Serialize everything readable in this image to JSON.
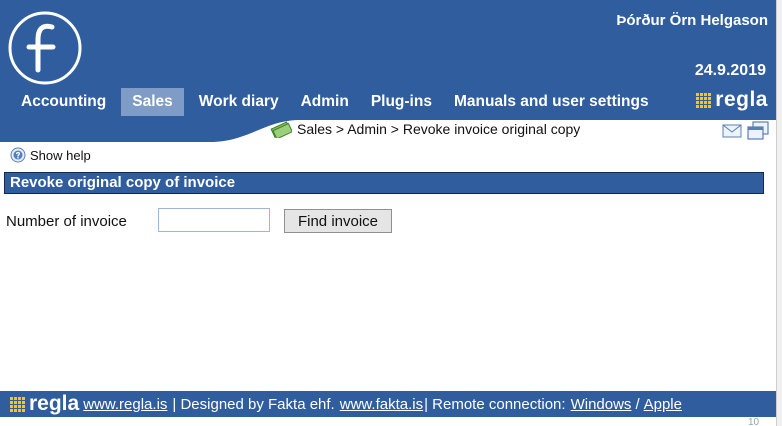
{
  "user": {
    "name": "Þórður Örn Helgason",
    "date": "24.9.2019"
  },
  "nav": {
    "items": [
      {
        "label": "Accounting"
      },
      {
        "label": "Sales",
        "active": true
      },
      {
        "label": "Work diary"
      },
      {
        "label": "Admin"
      },
      {
        "label": "Plug-ins"
      },
      {
        "label": "Manuals and user settings"
      }
    ]
  },
  "brand": {
    "name": "regla",
    "accent": "#f3c330",
    "bar_color": "#2f5d9e"
  },
  "breadcrumb": {
    "text": "Sales > Admin > Revoke invoice original copy"
  },
  "help": {
    "label": "Show help"
  },
  "section": {
    "title": "Revoke original copy of invoice"
  },
  "form": {
    "invoice_label": "Number of invoice",
    "invoice_value": "",
    "find_label": "Find invoice"
  },
  "footer": {
    "link1": "www.regla.is",
    "text1": "| Designed by Fakta ehf.",
    "link2": "www.fakta.is",
    "text2": "| Remote connection:",
    "link3": "Windows",
    "sep": "/",
    "link4": "Apple"
  },
  "corner": "10"
}
